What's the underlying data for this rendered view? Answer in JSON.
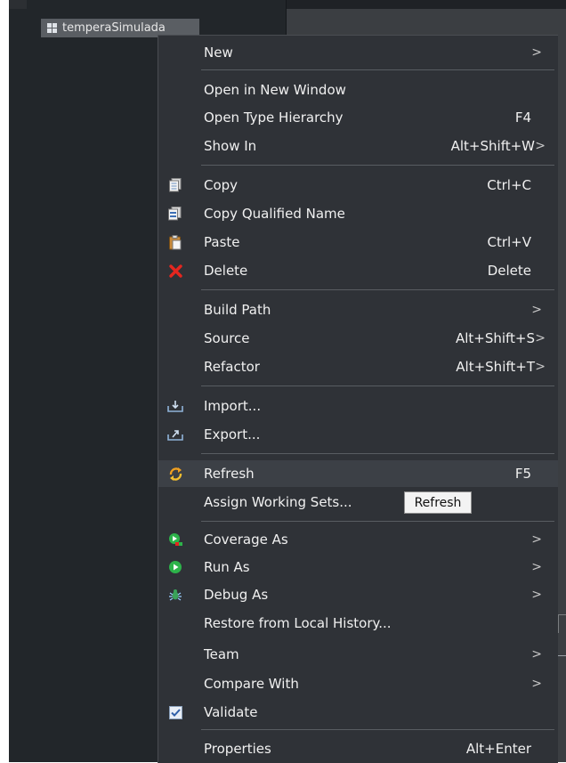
{
  "tree": {
    "item_label": "temperaSimulada",
    "item_icon": "package-icon"
  },
  "menu": {
    "new": {
      "label": "New",
      "submenu": ">"
    },
    "open_in_new_window": {
      "label": "Open in New Window"
    },
    "open_type_hierarchy": {
      "label": "Open Type Hierarchy",
      "shortcut": "F4"
    },
    "show_in": {
      "label": "Show In",
      "shortcut": "Alt+Shift+W",
      "submenu": ">"
    },
    "copy": {
      "label": "Copy",
      "shortcut": "Ctrl+C",
      "icon": "copy-icon"
    },
    "copy_qualified_name": {
      "label": "Copy Qualified Name",
      "icon": "copy-qualified-name-icon"
    },
    "paste": {
      "label": "Paste",
      "shortcut": "Ctrl+V",
      "icon": "paste-icon"
    },
    "delete": {
      "label": "Delete",
      "shortcut": "Delete",
      "icon": "delete-icon"
    },
    "build_path": {
      "label": "Build Path",
      "submenu": ">"
    },
    "source": {
      "label": "Source",
      "shortcut": "Alt+Shift+S",
      "submenu": ">"
    },
    "refactor": {
      "label": "Refactor",
      "shortcut": "Alt+Shift+T",
      "submenu": ">"
    },
    "import": {
      "label": "Import...",
      "icon": "import-icon"
    },
    "export": {
      "label": "Export...",
      "icon": "export-icon"
    },
    "refresh": {
      "label": "Refresh",
      "shortcut": "F5",
      "icon": "refresh-icon"
    },
    "assign_working_sets": {
      "label": "Assign Working Sets..."
    },
    "coverage_as": {
      "label": "Coverage As",
      "submenu": ">",
      "icon": "coverage-icon"
    },
    "run_as": {
      "label": "Run As",
      "submenu": ">",
      "icon": "run-icon"
    },
    "debug_as": {
      "label": "Debug As",
      "submenu": ">",
      "icon": "debug-bug-icon"
    },
    "restore_from_local_history": {
      "label": "Restore from Local History..."
    },
    "team": {
      "label": "Team",
      "submenu": ">"
    },
    "compare_with": {
      "label": "Compare With",
      "submenu": ">"
    },
    "validate": {
      "label": "Validate",
      "icon": "validate-check-icon"
    },
    "properties": {
      "label": "Properties",
      "shortcut": "Alt+Enter"
    }
  },
  "tooltip": {
    "text": "Refresh"
  },
  "colors": {
    "menu_bg": "#2f3237",
    "highlight": "#3c4046",
    "delete_red": "#e5261f",
    "run_green": "#2db34a"
  }
}
